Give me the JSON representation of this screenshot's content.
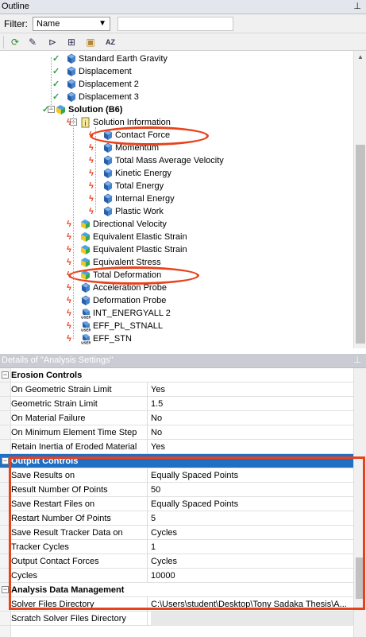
{
  "outline": {
    "title": "Outline",
    "pin_icon": "pin-icon",
    "filter_label": "Filter:",
    "filter_value": "Name",
    "filter_text": "",
    "toolbar": [
      {
        "name": "refresh-icon",
        "glyph": "⟳"
      },
      {
        "name": "edit-icon",
        "glyph": "✎"
      },
      {
        "name": "tree-icon",
        "glyph": "⊳"
      },
      {
        "name": "expand-all-icon",
        "glyph": "⊞"
      },
      {
        "name": "folder-icon",
        "glyph": "▣"
      },
      {
        "name": "sort-az-icon",
        "glyph": "AZ"
      }
    ]
  },
  "tree": {
    "items": [
      {
        "label": "Standard Earth Gravity",
        "icon": "gravity-icon"
      },
      {
        "label": "Displacement",
        "icon": "displacement-icon"
      },
      {
        "label": "Displacement 2",
        "icon": "displacement-icon"
      },
      {
        "label": "Displacement 3",
        "icon": "displacement-icon"
      },
      {
        "label": "Solution (B6)",
        "icon": "solution-icon"
      },
      {
        "label": "Solution Information",
        "icon": "info-icon"
      },
      {
        "label": "Contact Force",
        "icon": "probe-icon"
      },
      {
        "label": "Momentum",
        "icon": "probe-icon"
      },
      {
        "label": "Total Mass Average Velocity",
        "icon": "probe-icon"
      },
      {
        "label": "Kinetic Energy",
        "icon": "probe-icon"
      },
      {
        "label": "Total Energy",
        "icon": "probe-icon"
      },
      {
        "label": "Internal Energy",
        "icon": "probe-icon"
      },
      {
        "label": "Plastic Work",
        "icon": "probe-icon"
      },
      {
        "label": "Directional Velocity",
        "icon": "result-icon"
      },
      {
        "label": "Equivalent Elastic Strain",
        "icon": "result-icon"
      },
      {
        "label": "Equivalent Plastic Strain",
        "icon": "result-icon"
      },
      {
        "label": "Equivalent Stress",
        "icon": "result-icon"
      },
      {
        "label": "Total Deformation",
        "icon": "result-icon"
      },
      {
        "label": "Acceleration Probe",
        "icon": "probe-icon"
      },
      {
        "label": "Deformation Probe",
        "icon": "probe-icon"
      },
      {
        "label": "INT_ENERGYALL 2",
        "icon": "user-result-icon"
      },
      {
        "label": "EFF_PL_STNALL",
        "icon": "user-result-icon"
      },
      {
        "label": "EFF_STN",
        "icon": "user-result-icon"
      }
    ]
  },
  "details": {
    "title": "Details of \"Analysis Settings\"",
    "pin_icon": "pin-icon",
    "rows": [
      {
        "type": "group",
        "key": "Erosion Controls"
      },
      {
        "type": "prop",
        "key": "On Geometric Strain Limit",
        "value": "Yes"
      },
      {
        "type": "prop",
        "key": "Geometric Strain Limit",
        "value": "1.5"
      },
      {
        "type": "prop",
        "key": "On Material Failure",
        "value": "No"
      },
      {
        "type": "prop",
        "key": "On Minimum Element Time Step",
        "value": "No"
      },
      {
        "type": "prop",
        "key": "Retain Inertia of Eroded Material",
        "value": "Yes"
      },
      {
        "type": "group",
        "key": "Output Controls",
        "selected": true
      },
      {
        "type": "prop",
        "key": "Save Results on",
        "value": "Equally Spaced Points"
      },
      {
        "type": "prop",
        "key": "Result Number Of Points",
        "value": "50"
      },
      {
        "type": "prop",
        "key": "Save Restart Files on",
        "value": "Equally Spaced Points"
      },
      {
        "type": "prop",
        "key": "Restart Number Of Points",
        "value": "5"
      },
      {
        "type": "prop",
        "key": "Save Result Tracker Data on",
        "value": "Cycles"
      },
      {
        "type": "prop",
        "key": "Tracker Cycles",
        "value": "1"
      },
      {
        "type": "prop",
        "key": "Output Contact Forces",
        "value": "Cycles"
      },
      {
        "type": "prop",
        "key": "Cycles",
        "value": "10000"
      },
      {
        "type": "group",
        "key": "Analysis Data Management"
      },
      {
        "type": "prop",
        "key": "Solver Files Directory",
        "value": "C:\\Users\\student\\Desktop\\Tony Sadaka Thesis\\A..."
      },
      {
        "type": "prop",
        "key": "Scratch Solver Files Directory",
        "value": "",
        "greyval": true
      }
    ]
  },
  "colors": {
    "highlight": "#e8421d",
    "selection": "#1f6fc4",
    "check": "#2ea043",
    "bolt": "#e8421d"
  }
}
